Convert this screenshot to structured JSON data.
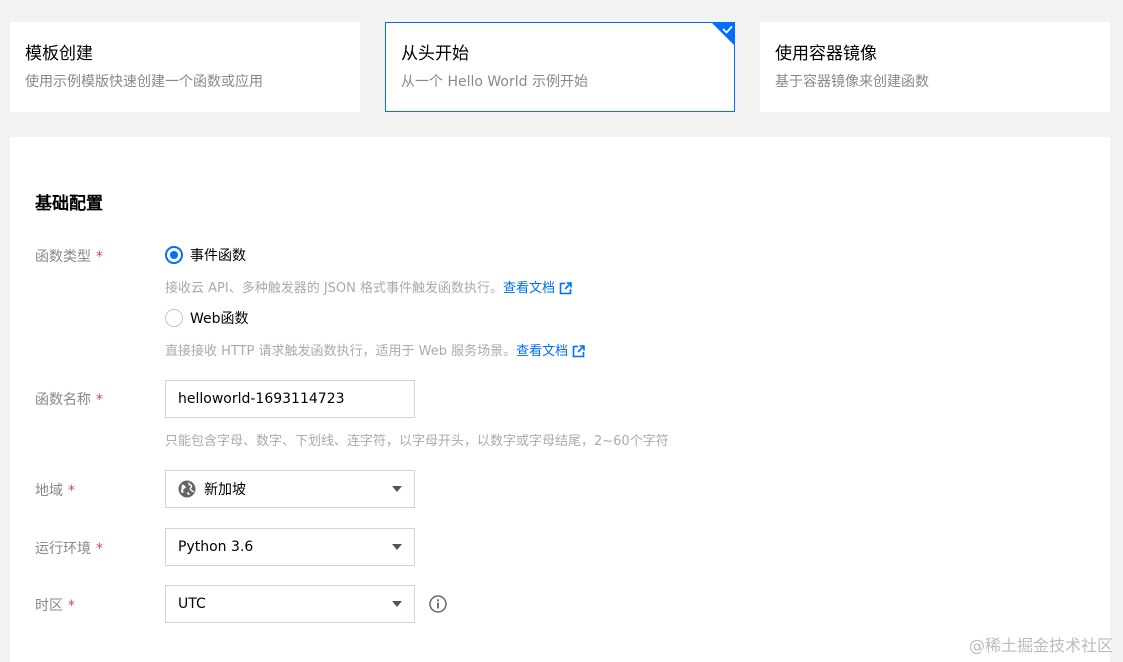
{
  "cards": [
    {
      "title": "模板创建",
      "desc": "使用示例模版快速创建一个函数或应用",
      "selected": false
    },
    {
      "title": "从头开始",
      "desc": "从一个 Hello World 示例开始",
      "selected": true
    },
    {
      "title": "使用容器镜像",
      "desc": "基于容器镜像来创建函数",
      "selected": false
    }
  ],
  "section": {
    "title": "基础配置"
  },
  "function_type": {
    "label": "函数类型",
    "required_mark": "*",
    "options": [
      {
        "label": "事件函数",
        "hint": "接收云 API、多种触发器的 JSON 格式事件触发函数执行。",
        "link": "查看文档",
        "checked": true
      },
      {
        "label": "Web函数",
        "hint": "直接接收 HTTP 请求触发函数执行，适用于 Web 服务场景。",
        "link": "查看文档",
        "checked": false
      }
    ]
  },
  "function_name": {
    "label": "函数名称",
    "required_mark": "*",
    "value": "helloworld-1693114723",
    "hint": "只能包含字母、数字、下划线、连字符，以字母开头，以数字或字母结尾，2~60个字符"
  },
  "region": {
    "label": "地域",
    "required_mark": "*",
    "value": "新加坡"
  },
  "runtime": {
    "label": "运行环境",
    "required_mark": "*",
    "value": "Python 3.6"
  },
  "timezone": {
    "label": "时区",
    "required_mark": "*",
    "value": "UTC"
  },
  "watermark": "@稀土掘金技术社区",
  "colors": {
    "accent": "#006eff",
    "required": "#e54545"
  }
}
